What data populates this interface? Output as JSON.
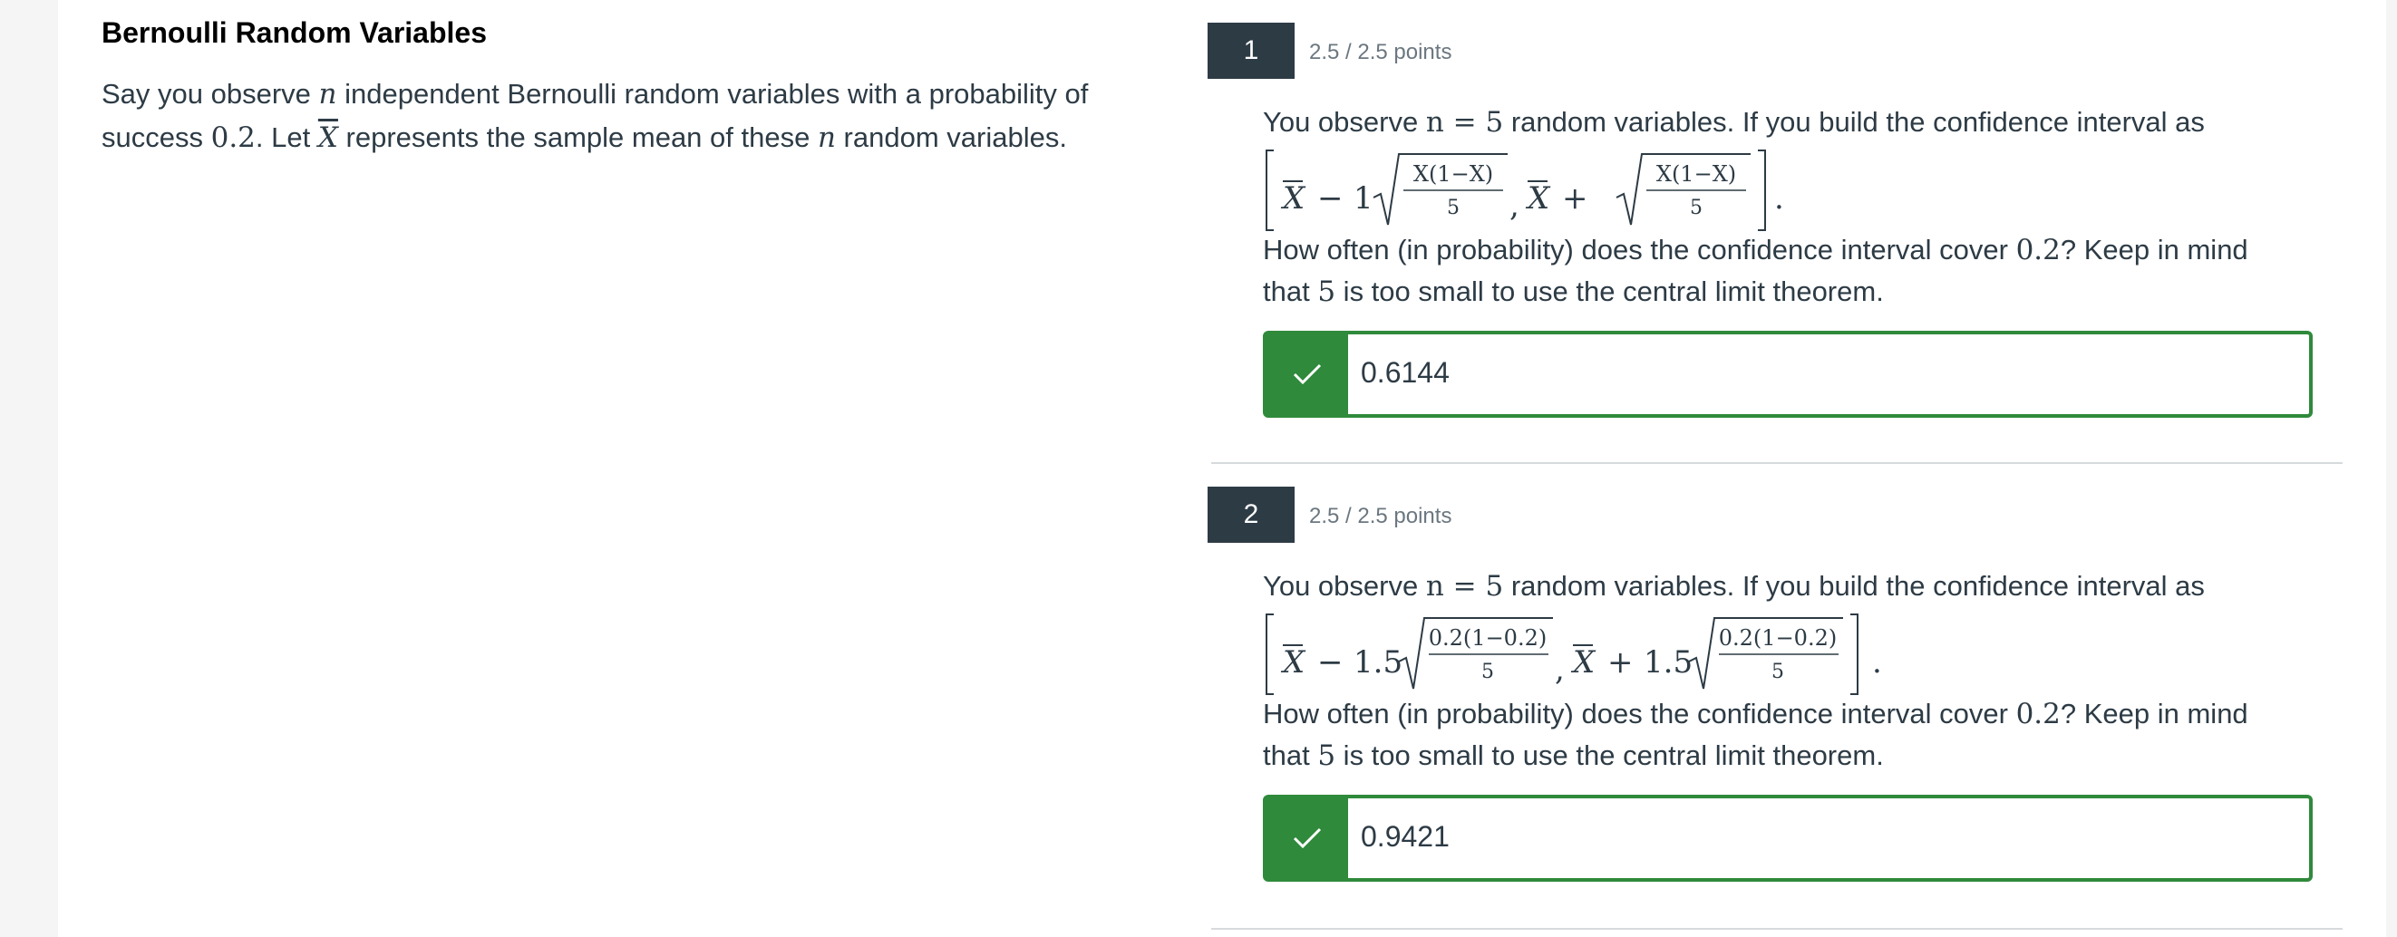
{
  "left": {
    "title": "Bernoulli Random Variables",
    "intro_1": "Say you observe ",
    "n": "n",
    "intro_2": " independent Bernoulli random variables with a probability of success ",
    "p": "0.2",
    "intro_3": ". Let ",
    "xbar": "X",
    "intro_4": " represents the sample mean of these ",
    "intro_5": " random variables."
  },
  "questions": [
    {
      "number": "1",
      "points": "2.5 / 2.5 points",
      "text_a1": "You observe ",
      "text_a2": "n = 5",
      "text_a3": " random variables.  If you build the confidence interval as",
      "formula": {
        "coef": "1",
        "num_left": "X(1−X)",
        "den": "5",
        "num_right": "X(1−X)"
      },
      "text_b1": "How often (in probability) does the confidence interval cover ",
      "text_b2": "0.2",
      "text_b3": "? Keep in mind",
      "text_c1": "that ",
      "text_c2": "5",
      "text_c3": " is too small to use the central limit theorem.",
      "answer": "0.6144",
      "status": "correct"
    },
    {
      "number": "2",
      "points": "2.5 / 2.5 points",
      "text_a1": "You observe ",
      "text_a2": "n = 5",
      "text_a3": " random variables.  If you build the confidence interval as",
      "formula": {
        "coef": "1.5",
        "num_left": "0.2(1−0.2)",
        "den": "5",
        "num_right": "0.2(1−0.2)"
      },
      "text_b1": "How often (in probability) does the confidence interval cover ",
      "text_b2": "0.2",
      "text_b3": "? Keep in mind",
      "text_c1": "that ",
      "text_c2": "5",
      "text_c3": " is too small to use the central limit theorem.",
      "answer": "0.9421",
      "status": "correct"
    }
  ],
  "colors": {
    "correct": "#2f8a3b",
    "number_badge": "#2d3b45"
  },
  "icons": {
    "check": "check-icon"
  }
}
